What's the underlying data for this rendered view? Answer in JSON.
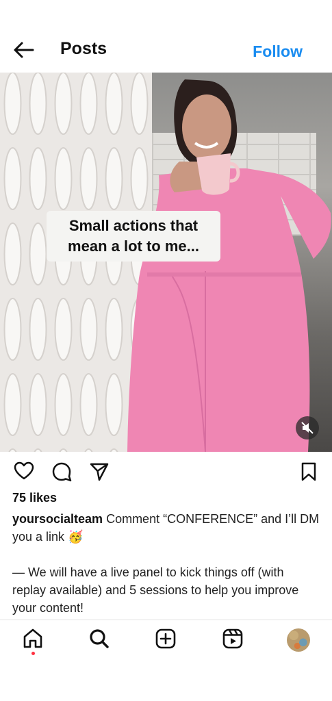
{
  "header": {
    "title": "Posts",
    "follow_label": "Follow"
  },
  "media": {
    "overlay_line1": "Small actions that",
    "overlay_line2": "mean a lot to me..."
  },
  "post": {
    "likes": "75 likes",
    "username": "yoursocialteam",
    "caption_line": " Comment “CONFERENCE” and I’ll DM you a link 🥳",
    "caption_para": "— We will have a live panel to kick things off (with replay available) and 5 sessions to help you improve your content!"
  },
  "icons": [
    "back-arrow-icon",
    "heart-icon",
    "comment-icon",
    "share-icon",
    "bookmark-icon",
    "mute-icon",
    "home-icon",
    "search-icon",
    "create-icon",
    "reels-icon"
  ],
  "colors": {
    "follow": "#1a8cf0",
    "dress": "#ef86b3",
    "notification_dot": "#ff3040"
  }
}
